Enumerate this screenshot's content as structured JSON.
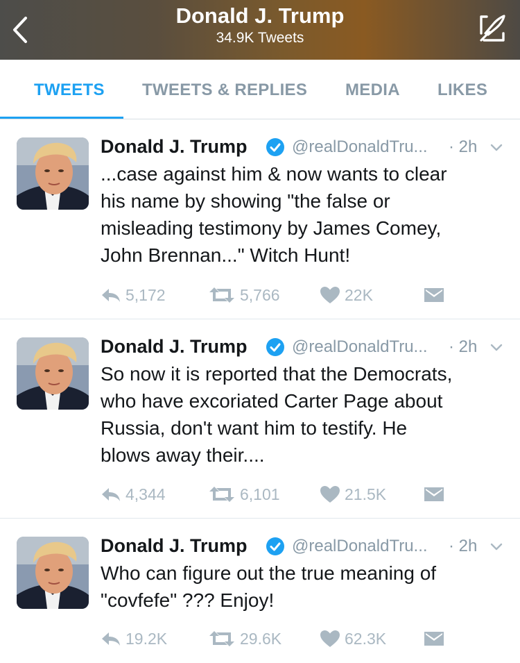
{
  "header": {
    "title": "Donald J. Trump",
    "subtitle": "34.9K Tweets",
    "back_icon": "chevron-left-icon",
    "compose_icon": "compose-quill-icon"
  },
  "tabs": [
    {
      "label": "TWEETS",
      "active": true
    },
    {
      "label": "TWEETS & REPLIES",
      "active": false
    },
    {
      "label": "MEDIA",
      "active": false
    },
    {
      "label": "LIKES",
      "active": false
    }
  ],
  "colors": {
    "accent": "#1da1f2",
    "muted": "#8899a6",
    "icon": "#aab8c2",
    "text": "#14171a"
  },
  "tweets": [
    {
      "name": "Donald J. Trump",
      "handle": "@realDonaldTru...",
      "time": "· 2h",
      "text": "...case against him & now wants to clear\nhis name by showing \"the false or\nmisleading testimony by James Comey,\nJohn Brennan...\" Witch Hunt!",
      "replies": "5,172",
      "retweets": "5,766",
      "likes": "22K"
    },
    {
      "name": "Donald J. Trump",
      "handle": "@realDonaldTru...",
      "time": "· 2h",
      "text": "So now it is reported that the Democrats,\nwho have excoriated Carter Page about\nRussia, don't want him to testify. He\nblows away their....",
      "replies": "4,344",
      "retweets": "6,101",
      "likes": "21.5K"
    },
    {
      "name": "Donald J. Trump",
      "handle": "@realDonaldTru...",
      "time": "· 2h",
      "text": "Who can figure out the true meaning of\n\"covfefe\" ???  Enjoy!",
      "replies": "19.2K",
      "retweets": "29.6K",
      "likes": "62.3K"
    }
  ]
}
